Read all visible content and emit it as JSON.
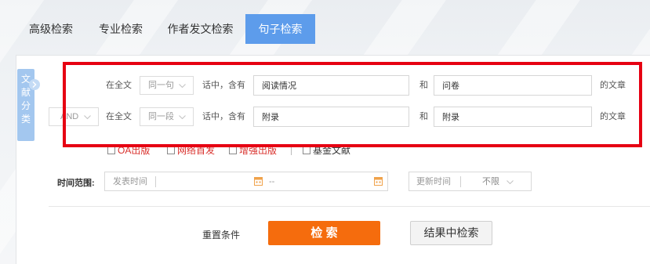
{
  "tabs": [
    {
      "label": "高级检索",
      "active": false
    },
    {
      "label": "专业检索",
      "active": false
    },
    {
      "label": "作者发文检索",
      "active": false
    },
    {
      "label": "句子检索",
      "active": true
    }
  ],
  "side_tab": {
    "label": "文献分类",
    "icon": "chevron-right-icon"
  },
  "rows": [
    {
      "scope": "在全文",
      "unit": "同一句",
      "contain": "话中，含有",
      "term1": "阅读情况",
      "conj": "和",
      "term2": "问卷",
      "suffix": "的文章"
    },
    {
      "logic": "AND",
      "scope": "在全文",
      "unit": "同一段",
      "contain": "话中，含有",
      "term1": "附录",
      "conj": "和",
      "term2": "附录",
      "suffix": "的文章"
    }
  ],
  "filters": [
    {
      "label": "OA出版",
      "checked": false
    },
    {
      "label": "网络首发",
      "checked": false
    },
    {
      "label": "增强出版",
      "checked": false
    },
    {
      "label": "基金文献",
      "checked": false
    }
  ],
  "time": {
    "label": "时间范围:",
    "publish_placeholder": "发表时间",
    "range_separator": "--",
    "update_label": "更新时间",
    "update_value": "不限"
  },
  "actions": {
    "reset": "重置条件",
    "search": "检 索",
    "search_in_results": "结果中检索"
  },
  "icons": {
    "select_arrow": "chevron-down-icon",
    "date_picker": "calendar-icon"
  },
  "colors": {
    "accent": "#5d9ceb",
    "side_tab": "#a3c7ef",
    "search_button": "#f56c0d",
    "filter_highlight": "#d9302c",
    "annotation_box": "#e60012"
  }
}
